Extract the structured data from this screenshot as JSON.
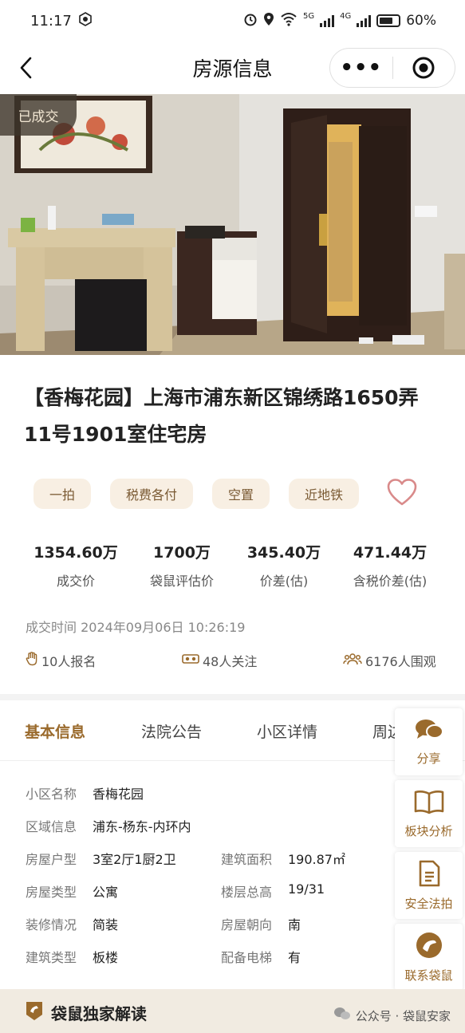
{
  "status_bar": {
    "time": "11:17",
    "network1": "5G",
    "network2": "4G",
    "battery": "60%"
  },
  "nav": {
    "title": "房源信息",
    "more_label": "•••"
  },
  "photo": {
    "status_badge": "已成交"
  },
  "house": {
    "title": "【香梅花园】上海市浦东新区锦绣路1650弄11号1901室住宅房"
  },
  "tags": [
    "一拍",
    "税费各付",
    "空置",
    "近地铁"
  ],
  "stats": [
    {
      "value": "1354.60万",
      "label": "成交价"
    },
    {
      "value": "1700万",
      "label": "袋鼠评估价"
    },
    {
      "value": "345.40万",
      "label": "价差(估)"
    },
    {
      "value": "471.44万",
      "label": "含税价差(估)"
    }
  ],
  "deal_time": "成交时间 2024年09月06日 10:26:19",
  "meta": {
    "signups": "10人报名",
    "followers": "48人关注",
    "viewers": "6176人围观"
  },
  "tabs": [
    "基本信息",
    "法院公告",
    "小区详情",
    "周边"
  ],
  "basic_info": {
    "community_label": "小区名称",
    "community": "香梅花园",
    "area_label": "区域信息",
    "area": "浦东-杨东-内环内",
    "layout_label": "房屋户型",
    "layout": "3室2厅1厨2卫",
    "floor_area_label": "建筑面积",
    "floor_area": "190.87㎡",
    "type_label": "房屋类型",
    "type": "公寓",
    "floors_label": "楼层总高",
    "floors": "19/31",
    "decor_label": "装修情况",
    "decor": "简装",
    "orientation_label": "房屋朝向",
    "orientation": "南",
    "building_label": "建筑类型",
    "building": "板楼",
    "elevator_label": "配备电梯",
    "elevator": "有"
  },
  "side_buttons": {
    "share": "分享",
    "analysis": "板块分析",
    "safe": "安全法拍",
    "contact": "联系袋鼠"
  },
  "bottom": {
    "exclusive": "袋鼠独家解读",
    "watermark": "公众号 · 袋鼠安家"
  },
  "colors": {
    "accent": "#9a6a2c",
    "tag_bg": "#f8efe3",
    "heart": "#d98a8a"
  }
}
